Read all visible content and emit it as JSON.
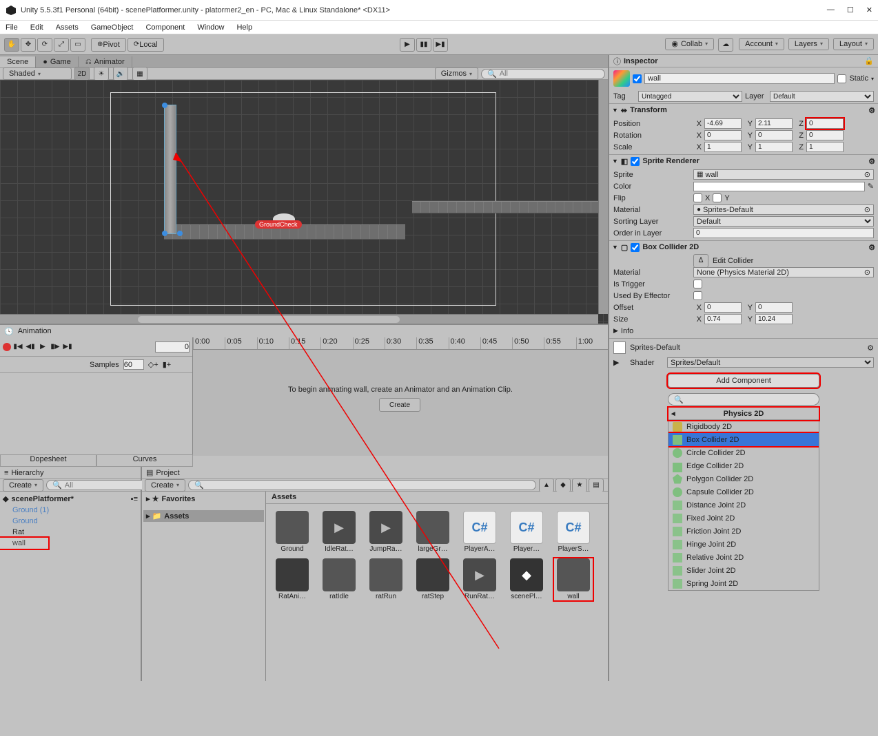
{
  "window": {
    "title": "Unity 5.5.3f1 Personal (64bit) - scenePlatformer.unity - platormer2_en - PC, Mac & Linux Standalone* <DX11>"
  },
  "menu": [
    "File",
    "Edit",
    "Assets",
    "GameObject",
    "Component",
    "Window",
    "Help"
  ],
  "toolbar": {
    "pivot": "Pivot",
    "local": "Local",
    "collab": "Collab",
    "account": "Account",
    "layers": "Layers",
    "layout": "Layout"
  },
  "tabs": {
    "scene": "Scene",
    "game": "Game",
    "animator": "Animator"
  },
  "sceneBar": {
    "shaded": "Shaded",
    "mode2d": "2D",
    "gizmos": "Gizmos",
    "search": "All"
  },
  "sceneObjects": {
    "groundCheck": "GroundCheck"
  },
  "animation": {
    "title": "Animation",
    "frame": "0",
    "samples_label": "Samples",
    "samples_value": "60",
    "ruler": [
      "0:00",
      "0:05",
      "0:10",
      "0:15",
      "0:20",
      "0:25",
      "0:30",
      "0:35",
      "0:40",
      "0:45",
      "0:50",
      "0:55",
      "1:00"
    ],
    "msg": "To begin animating wall, create an Animator and an Animation Clip.",
    "create": "Create",
    "dope": "Dopesheet",
    "curves": "Curves"
  },
  "hierarchy": {
    "title": "Hierarchy",
    "create": "Create",
    "search": "All",
    "scene": "scenePlatformer*",
    "items": [
      "Ground (1)",
      "Ground",
      "Rat",
      "wall"
    ]
  },
  "project": {
    "title": "Project",
    "create": "Create",
    "favorites": "Favorites",
    "assetsFolder": "Assets",
    "path": "Assets",
    "assets": [
      {
        "label": "Ground",
        "kind": "img"
      },
      {
        "label": "IdleRat…",
        "kind": "play"
      },
      {
        "label": "JumpRa…",
        "kind": "play"
      },
      {
        "label": "largeGr…",
        "kind": "img"
      },
      {
        "label": "PlayerA…",
        "kind": "cs"
      },
      {
        "label": "Player…",
        "kind": "cs"
      },
      {
        "label": "PlayerS…",
        "kind": "cs"
      },
      {
        "label": "RatAni…",
        "kind": "anim"
      },
      {
        "label": "ratIdle",
        "kind": "img"
      },
      {
        "label": "ratRun",
        "kind": "img"
      },
      {
        "label": "ratStep",
        "kind": "anim"
      },
      {
        "label": "RunRat…",
        "kind": "play"
      },
      {
        "label": "scenePl…",
        "kind": "unity"
      },
      {
        "label": "wall",
        "kind": "img"
      }
    ]
  },
  "inspector": {
    "title": "Inspector",
    "name": "wall",
    "static": "Static",
    "tag_label": "Tag",
    "tag": "Untagged",
    "layer_label": "Layer",
    "layer": "Default",
    "transform": {
      "title": "Transform",
      "position": "Position",
      "rotation": "Rotation",
      "scale": "Scale",
      "px": "-4.69",
      "py": "2.11",
      "pz": "0",
      "rx": "0",
      "ry": "0",
      "rz": "0",
      "sx": "1",
      "sy": "1",
      "sz": "1"
    },
    "sprite": {
      "title": "Sprite Renderer",
      "sprite_l": "Sprite",
      "sprite_v": "wall",
      "color_l": "Color",
      "flip_l": "Flip",
      "flip_x": "X",
      "flip_y": "Y",
      "mat_l": "Material",
      "mat_v": "Sprites-Default",
      "sort_l": "Sorting Layer",
      "sort_v": "Default",
      "order_l": "Order in Layer",
      "order_v": "0"
    },
    "box": {
      "title": "Box Collider 2D",
      "edit": "Edit Collider",
      "mat_l": "Material",
      "mat_v": "None (Physics Material 2D)",
      "trig_l": "Is Trigger",
      "eff_l": "Used By Effector",
      "off_l": "Offset",
      "ox": "0",
      "oy": "0",
      "size_l": "Size",
      "sx": "0.74",
      "sy": "10.24",
      "info": "Info"
    },
    "shader": {
      "name": "Sprites-Default",
      "label": "Shader",
      "value": "Sprites/Default"
    },
    "addcomp": "Add Component",
    "menu": {
      "title": "Physics 2D",
      "items": [
        {
          "label": "Rigidbody 2D",
          "ico": "rb"
        },
        {
          "label": "Box Collider 2D",
          "ico": "bc",
          "sel": true
        },
        {
          "label": "Circle Collider 2D",
          "ico": "cc"
        },
        {
          "label": "Edge Collider 2D",
          "ico": "ec"
        },
        {
          "label": "Polygon Collider 2D",
          "ico": "pc"
        },
        {
          "label": "Capsule Collider 2D",
          "ico": "cap"
        },
        {
          "label": "Distance Joint 2D",
          "ico": "dj"
        },
        {
          "label": "Fixed Joint 2D",
          "ico": "fj"
        },
        {
          "label": "Friction Joint 2D",
          "ico": "frj"
        },
        {
          "label": "Hinge Joint 2D",
          "ico": "hj"
        },
        {
          "label": "Relative Joint 2D",
          "ico": "rj"
        },
        {
          "label": "Slider Joint 2D",
          "ico": "sj"
        },
        {
          "label": "Spring Joint 2D",
          "ico": "spj"
        }
      ]
    }
  }
}
